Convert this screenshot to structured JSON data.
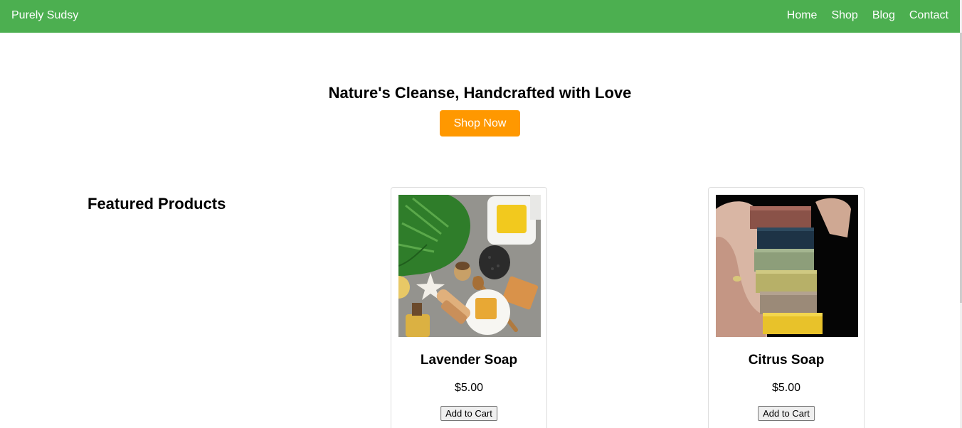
{
  "header": {
    "brand": "Purely Sudsy",
    "nav": [
      "Home",
      "Shop",
      "Blog",
      "Contact"
    ]
  },
  "hero": {
    "title": "Nature's Cleanse, Handcrafted with Love",
    "cta": "Shop Now"
  },
  "featured": {
    "title": "Featured Products",
    "products": [
      {
        "name": "Lavender Soap",
        "price": "$5.00",
        "button": "Add to Cart",
        "image": "soap-flatlay-photo"
      },
      {
        "name": "Citrus Soap",
        "price": "$5.00",
        "button": "Add to Cart",
        "image": "stacked-soap-bars-photo"
      }
    ]
  },
  "colors": {
    "nav_bg": "#4caf50",
    "cta_bg": "#ff9800"
  }
}
